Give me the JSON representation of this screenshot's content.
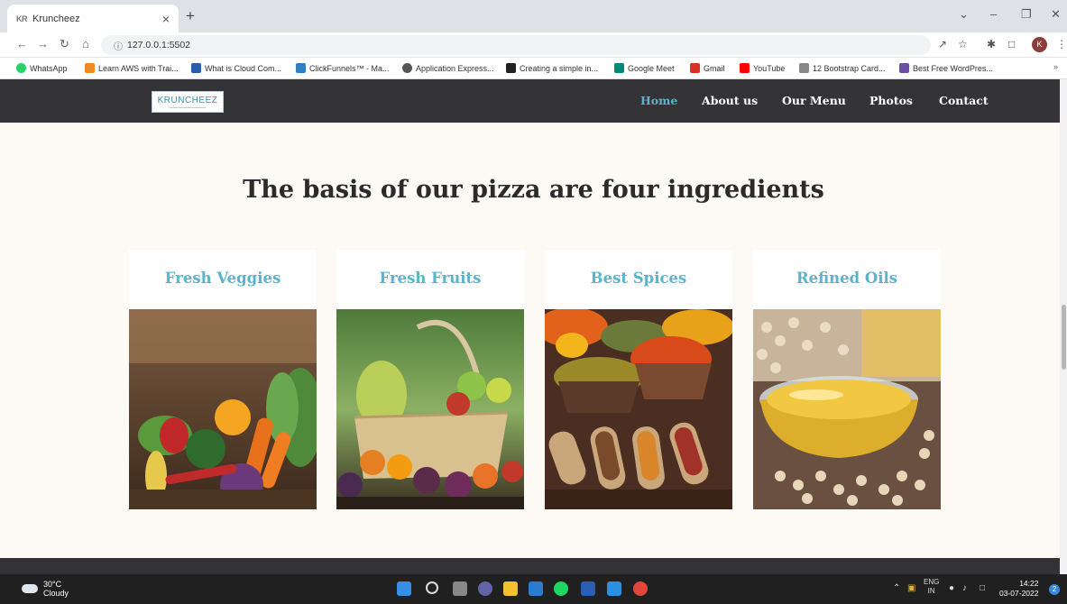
{
  "browser": {
    "tab_favicon": "KR",
    "tab_title": "Kruncheez",
    "tab_close": "×",
    "new_tab": "+",
    "url": "127.0.0.1:5502",
    "avatar_letter": "K",
    "bookmarks": [
      {
        "label": "WhatsApp",
        "color": "#25d366"
      },
      {
        "label": "Learn AWS with Trai...",
        "color": "#f08a24"
      },
      {
        "label": "What is Cloud Com...",
        "color": "#2a5db0"
      },
      {
        "label": "ClickFunnels™ - Ma...",
        "color": "#2f7fc1"
      },
      {
        "label": "Application Express...",
        "color": "#555555"
      },
      {
        "label": "Creating a simple in...",
        "color": "#222222"
      },
      {
        "label": "Google Meet",
        "color": "#00897b"
      },
      {
        "label": "Gmail",
        "color": "#d93025"
      },
      {
        "label": "YouTube",
        "color": "#ff0000"
      },
      {
        "label": "12 Bootstrap Card...",
        "color": "#888888"
      },
      {
        "label": "Best Free WordPres...",
        "color": "#6b4fa3"
      }
    ],
    "bookmarks_more": "»"
  },
  "site": {
    "logo_text": "KRUNCHEEZ",
    "nav": [
      "Home",
      "About us",
      "Our Menu",
      "Photos",
      "Contact"
    ],
    "active_nav": "Home",
    "accent_color": "#59b4cc",
    "heading": "The basis of our pizza are four ingredients",
    "cards": [
      {
        "title": "Fresh Veggies",
        "image": "vegetables-photo"
      },
      {
        "title": "Fresh Fruits",
        "image": "fruit-basket-photo"
      },
      {
        "title": "Best Spices",
        "image": "spices-photo"
      },
      {
        "title": "Refined Oils",
        "image": "oil-bowl-photo"
      }
    ]
  },
  "taskbar": {
    "temperature": "30°C",
    "condition": "Cloudy",
    "language_top": "ENG",
    "language_bottom": "IN",
    "time": "14:22",
    "date": "03-07-2022",
    "notification_count": "2"
  }
}
